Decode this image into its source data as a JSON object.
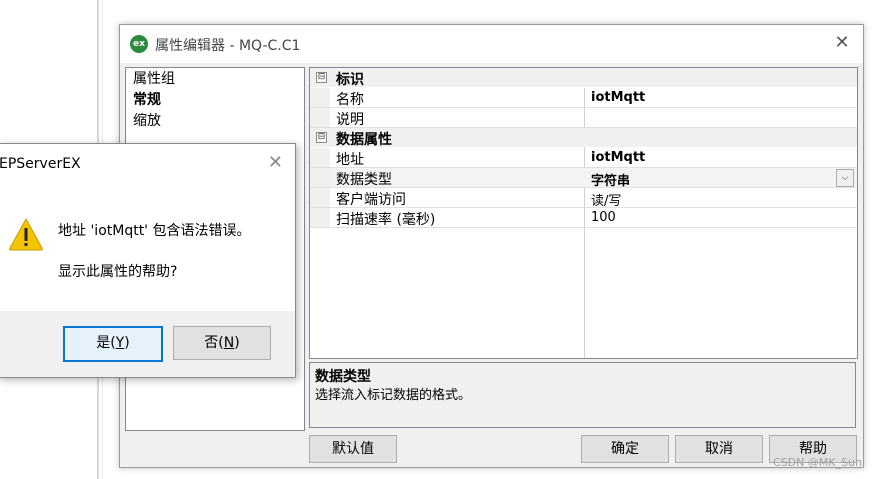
{
  "window": {
    "logo_text": "ex",
    "title": "属性编辑器 - MQ-C.C1",
    "close": "✕"
  },
  "tree": {
    "items": [
      "属性组",
      "常规",
      "缩放"
    ],
    "selected": "常规"
  },
  "grid": {
    "categories": [
      {
        "label": "标识",
        "toggle": "⊟",
        "props": [
          {
            "name": "名称",
            "value": "iotMqtt"
          },
          {
            "name": "说明",
            "value": ""
          }
        ]
      },
      {
        "label": "数据属性",
        "toggle": "⊟",
        "props": [
          {
            "name": "地址",
            "value": "iotMqtt"
          },
          {
            "name": "数据类型",
            "value": "字符串"
          },
          {
            "name": "客户端访问",
            "value": "读/写"
          },
          {
            "name": "扫描速率 (毫秒)",
            "value": "100"
          }
        ]
      }
    ],
    "dropdown_glyph": "⌵"
  },
  "description": {
    "title": "数据类型",
    "text": "选择流入标记数据的格式。"
  },
  "buttons": {
    "defaults": "默认值",
    "ok": "确定",
    "cancel": "取消",
    "help": "帮助"
  },
  "message_box": {
    "title": "EPServerEX",
    "close": "✕",
    "icon": "warning-icon",
    "line1": "地址 'iotMqtt' 包含语法错误。",
    "line2": "显示此属性的帮助?",
    "yes_label": "是(",
    "yes_key": "Y",
    "yes_end": ")",
    "no_label": "否(",
    "no_key": "N",
    "no_end": ")"
  },
  "watermark": "CSDN @MK_Sun",
  "colors": {
    "accent": "#0078d7",
    "warning": "#f5c400",
    "logo": "#2e8b3e"
  }
}
